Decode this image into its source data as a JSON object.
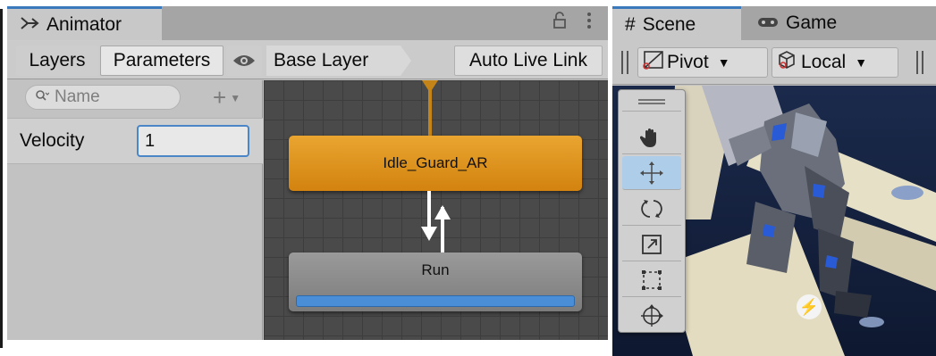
{
  "animator": {
    "tab_title": "Animator",
    "toolbar": {
      "layers_label": "Layers",
      "parameters_label": "Parameters",
      "breadcrumb": "Base Layer",
      "auto_live_link_label": "Auto Live Link"
    },
    "parameters": {
      "search_placeholder": "Name",
      "items": [
        {
          "name": "Velocity",
          "value": "1"
        }
      ]
    },
    "graph": {
      "states": [
        {
          "name": "Idle_Guard_AR",
          "color": "#e09a23",
          "is_default": true
        },
        {
          "name": "Run",
          "color": "#8e8e8e",
          "playing": true,
          "progress": 1.0
        }
      ]
    }
  },
  "scene": {
    "tabs": [
      {
        "label": "Scene",
        "active": true,
        "icon": "hash-icon"
      },
      {
        "label": "Game",
        "active": false,
        "icon": "gamepad-icon"
      }
    ],
    "toolbar": {
      "pivot_label": "Pivot",
      "local_label": "Local"
    },
    "tools": [
      "drag-handle",
      "hand-tool",
      "move-tool",
      "rotate-tool",
      "scale-tool",
      "rect-tool",
      "transform-tool"
    ],
    "active_tool": "move-tool"
  },
  "colors": {
    "accent": "#3a79bb",
    "default_state": "#e09a23",
    "progress": "#4a8ed8"
  }
}
